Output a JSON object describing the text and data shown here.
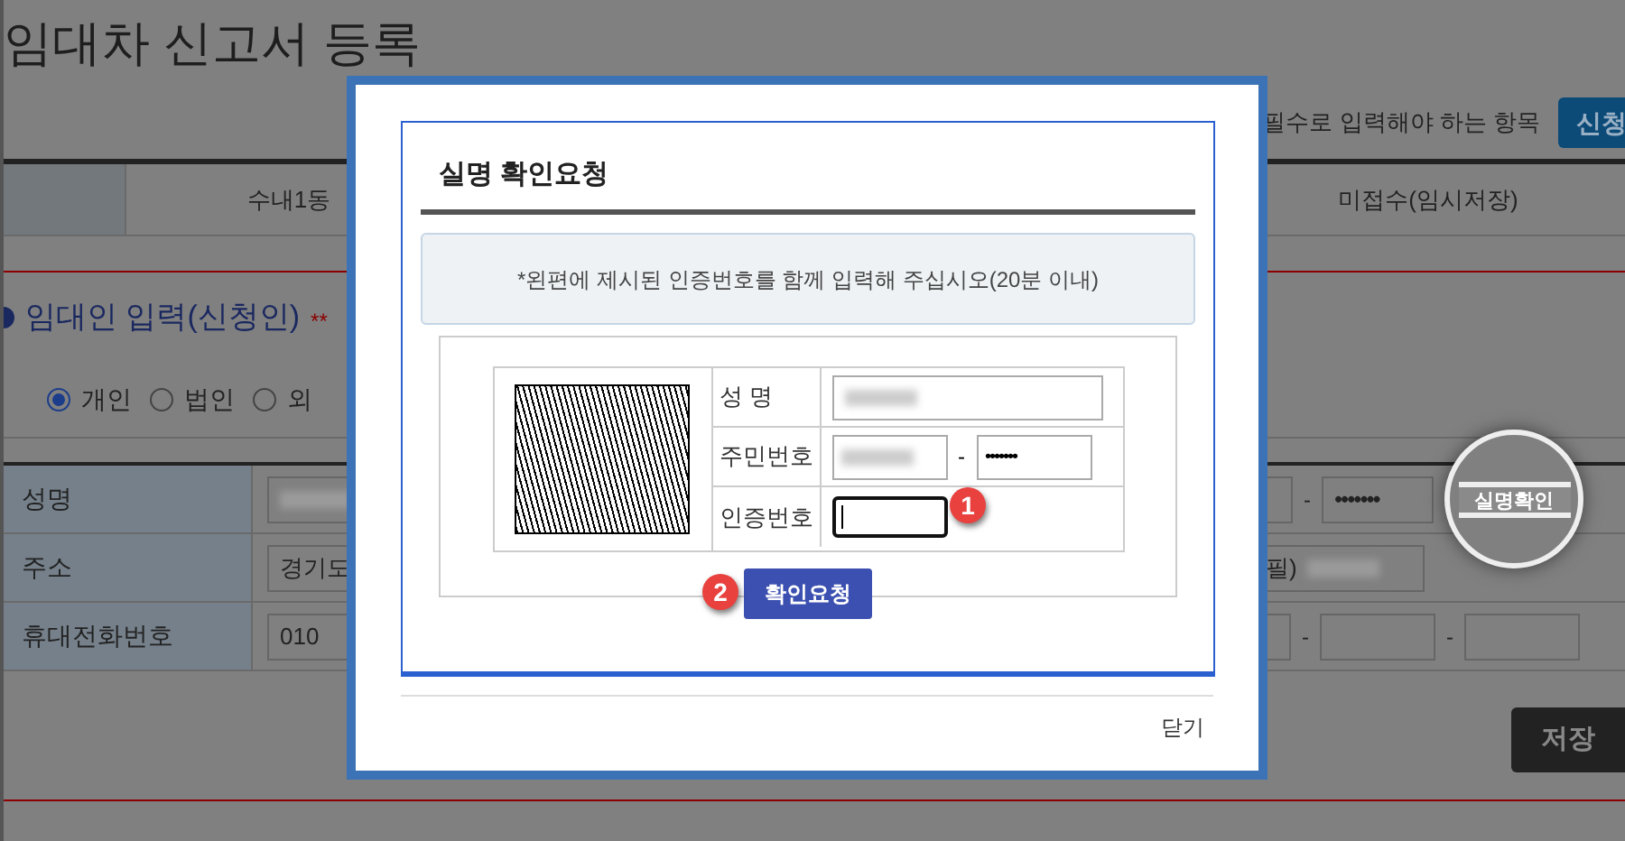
{
  "page_title": "임대차 신고서 등록",
  "required_note": "필수로 입력해야 하는 항목",
  "submit_button": "신청",
  "status_row": [
    "수내1동",
    "미접수(임시저장)"
  ],
  "section": {
    "title": "임대인 입력(신청인)",
    "note": "**"
  },
  "person_types": [
    {
      "label": "개인",
      "selected": true
    },
    {
      "label": "법인",
      "selected": false
    },
    {
      "label": "외",
      "selected": false
    }
  ],
  "form_rows": [
    {
      "label": "성명",
      "separator": "-",
      "password": "•••••••",
      "button": "실명확인"
    },
    {
      "label": "주소",
      "value": "경기도",
      "suffix": "필)"
    },
    {
      "label": "휴대전화번호",
      "value": "010",
      "separators": [
        "-",
        "-"
      ]
    }
  ],
  "save_button": "저장",
  "modal": {
    "title": "실명 확인요청",
    "notice": "*왼편에 제시된 인증번호를 함께 입력해 주십시오(20분 이내)",
    "fields": [
      {
        "label": "성 명",
        "kind": "name"
      },
      {
        "label": "주민번호",
        "kind": "id",
        "separator": "-",
        "password": "•••••••"
      },
      {
        "label": "인증번호",
        "kind": "code"
      }
    ],
    "confirm_button": "확인요청",
    "close_link": "닫기"
  },
  "callouts": [
    "1",
    "2"
  ]
}
